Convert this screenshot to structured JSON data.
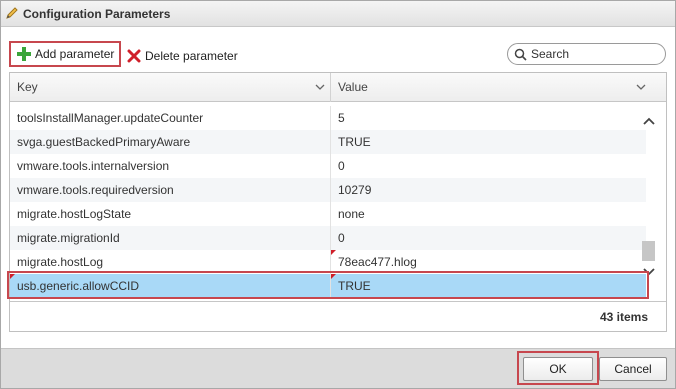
{
  "window": {
    "title": "Configuration Parameters"
  },
  "toolbar": {
    "add_label": "Add parameter",
    "delete_label": "Delete parameter",
    "search_placeholder": "Search"
  },
  "grid": {
    "columns": [
      {
        "label": "Key"
      },
      {
        "label": "Value"
      }
    ],
    "rows": [
      {
        "key": "toolsInstallManager.updateCounter",
        "value": "5"
      },
      {
        "key": "svga.guestBackedPrimaryAware",
        "value": "TRUE"
      },
      {
        "key": "vmware.tools.internalversion",
        "value": "0"
      },
      {
        "key": "vmware.tools.requiredversion",
        "value": "10279"
      },
      {
        "key": "migrate.hostLogState",
        "value": "none"
      },
      {
        "key": "migrate.migrationId",
        "value": "0"
      },
      {
        "key": "migrate.hostLog",
        "value": "78eac477.hlog"
      },
      {
        "key": "usb.generic.allowCCID",
        "value": "TRUE"
      }
    ],
    "selected_row": "usb.generic.allowCCID",
    "item_count": "43 items"
  },
  "buttons": {
    "ok_label": "OK",
    "cancel_label": "Cancel"
  },
  "icons": {
    "title": "pencil-icon",
    "add": "plus-icon",
    "delete": "x-icon",
    "search": "search-icon"
  },
  "colors": {
    "selection": "#a9d9f7",
    "highlight_outline": "#c7474e",
    "add_icon": "#3aa53a",
    "delete_icon": "#d0202a"
  }
}
